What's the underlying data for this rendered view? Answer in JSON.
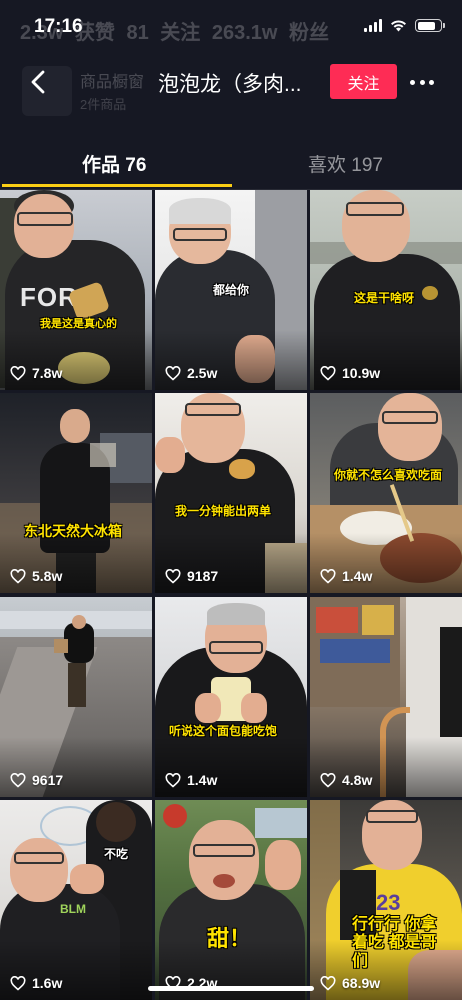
{
  "status_bar": {
    "time": "17:16",
    "bg_stats": "2.3w 获赞   81 关注   263.1w 粉丝",
    "battery_level": 0.8,
    "icons": [
      "signal-icon",
      "wifi-icon",
      "battery-icon"
    ]
  },
  "header": {
    "title": "泡泡龙（多肉...",
    "follow_label": "关注",
    "back_icon": "chevron-left-icon",
    "more_icon": "more-icon",
    "bg_shop_title": "商品橱窗",
    "bg_shop_sub": "2件商品"
  },
  "tabs": [
    {
      "label": "作品 76",
      "active": true
    },
    {
      "label": "喜欢 197",
      "active": false
    }
  ],
  "colors": {
    "background": "#161823",
    "accent": "#fe2c55",
    "tab_indicator": "#face15",
    "caption": "#ffe300"
  },
  "videos": [
    {
      "likes": "7.8w",
      "caption": "我是这是真心的"
    },
    {
      "likes": "2.5w",
      "caption": "都给你"
    },
    {
      "likes": "10.9w",
      "caption": "这是干啥呀"
    },
    {
      "likes": "5.8w",
      "caption": "东北天然大冰箱"
    },
    {
      "likes": "9187",
      "caption": "我一分钟能出两单"
    },
    {
      "likes": "1.4w",
      "caption": "你就不怎么喜欢吃面"
    },
    {
      "likes": "9617",
      "caption": ""
    },
    {
      "likes": "1.4w",
      "caption": "听说这个面包能吃饱"
    },
    {
      "likes": "4.8w",
      "caption": ""
    },
    {
      "likes": "1.6w",
      "caption": "不吃"
    },
    {
      "likes": "2.2w",
      "caption": "甜！"
    },
    {
      "likes": "68.9w",
      "caption": "行行行 你拿着吃 都是哥们"
    }
  ]
}
